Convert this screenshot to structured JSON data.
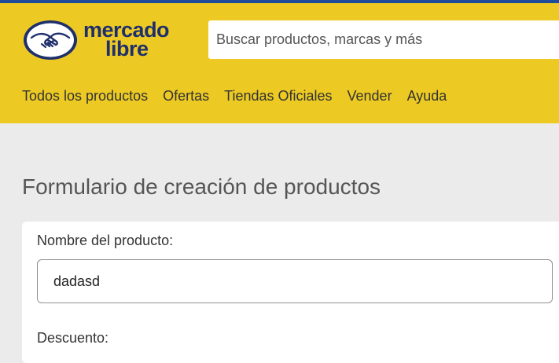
{
  "header": {
    "logo": {
      "line1": "mercado",
      "line2": "libre"
    },
    "search": {
      "placeholder": "Buscar productos, marcas y más",
      "value": ""
    },
    "nav": [
      "Todos los productos",
      "Ofertas",
      "Tiendas Oficiales",
      "Vender",
      "Ayuda"
    ]
  },
  "main": {
    "title": "Formulario de creación de productos",
    "form": {
      "name_label": "Nombre del producto:",
      "name_value": "dadasd",
      "discount_label": "Descuento:"
    }
  },
  "colors": {
    "brand_yellow": "#ecca23",
    "brand_blue": "#1f2f6b",
    "top_line": "#1f4d9a"
  },
  "icons": {
    "logo": "handshake-icon"
  }
}
